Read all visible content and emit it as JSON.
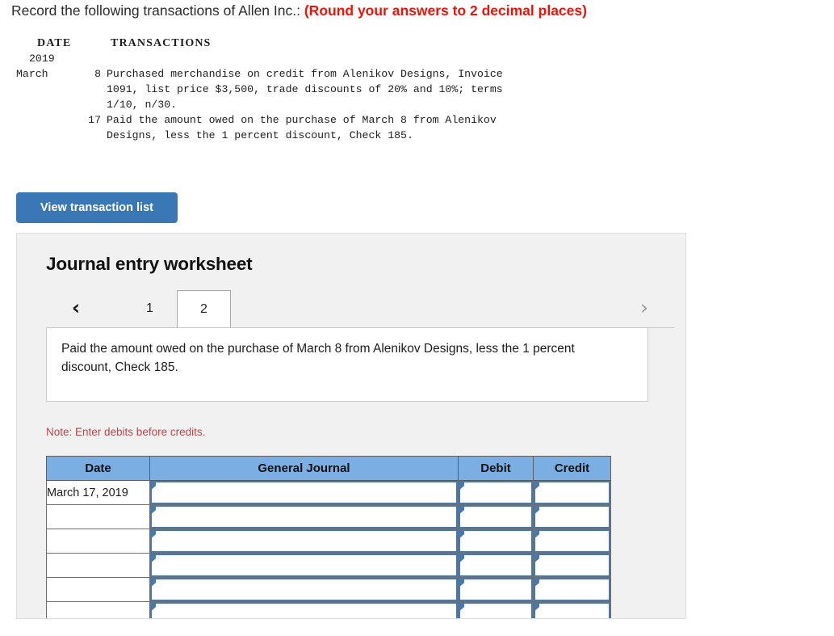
{
  "prompt": {
    "lead": "Record the following transactions of Allen Inc.:",
    "emphasis": "(Round your answers to 2 decimal places)"
  },
  "transaction_list": {
    "header_date": "DATE",
    "header_transactions": "TRANSACTIONS",
    "year": "2019",
    "month": "March",
    "entries": [
      {
        "day": "8",
        "lines": [
          "Purchased merchandise on credit from Alenikov Designs, Invoice",
          "1091, list price $3,500, trade discounts of 20% and 10%; terms",
          "1/10, n/30."
        ]
      },
      {
        "day": "17",
        "lines": [
          "Paid the amount owed on the purchase of March 8 from Alenikov",
          "Designs, less the 1 percent discount, Check 185."
        ]
      }
    ]
  },
  "view_button": {
    "label": "View transaction list"
  },
  "worksheet": {
    "title": "Journal entry worksheet",
    "prev_arrow": "‹",
    "next_arrow": "›",
    "tabs": [
      {
        "label": "1",
        "active": false
      },
      {
        "label": "2",
        "active": true
      }
    ],
    "description": "Paid the amount owed on the purchase of March 8 from Alenikov Designs, less the 1 percent discount, Check 185.",
    "note": "Note: Enter debits before credits.",
    "table": {
      "columns": [
        "Date",
        "General Journal",
        "Debit",
        "Credit"
      ],
      "rows": [
        {
          "date": "March 17, 2019",
          "general_journal": "",
          "debit": "",
          "credit": ""
        },
        {
          "date": "",
          "general_journal": "",
          "debit": "",
          "credit": ""
        },
        {
          "date": "",
          "general_journal": "",
          "debit": "",
          "credit": ""
        },
        {
          "date": "",
          "general_journal": "",
          "debit": "",
          "credit": ""
        },
        {
          "date": "",
          "general_journal": "",
          "debit": "",
          "credit": ""
        },
        {
          "date": "",
          "general_journal": "",
          "debit": "",
          "credit": ""
        }
      ]
    }
  },
  "colors": {
    "button_blue": "#3a78b5",
    "header_blue": "#7bafe4",
    "note_red": "#b74848",
    "emphasis_red": "#e8140b",
    "cell_border_blue": "#4a78ab",
    "panel_gray": "#f1f1f1"
  }
}
